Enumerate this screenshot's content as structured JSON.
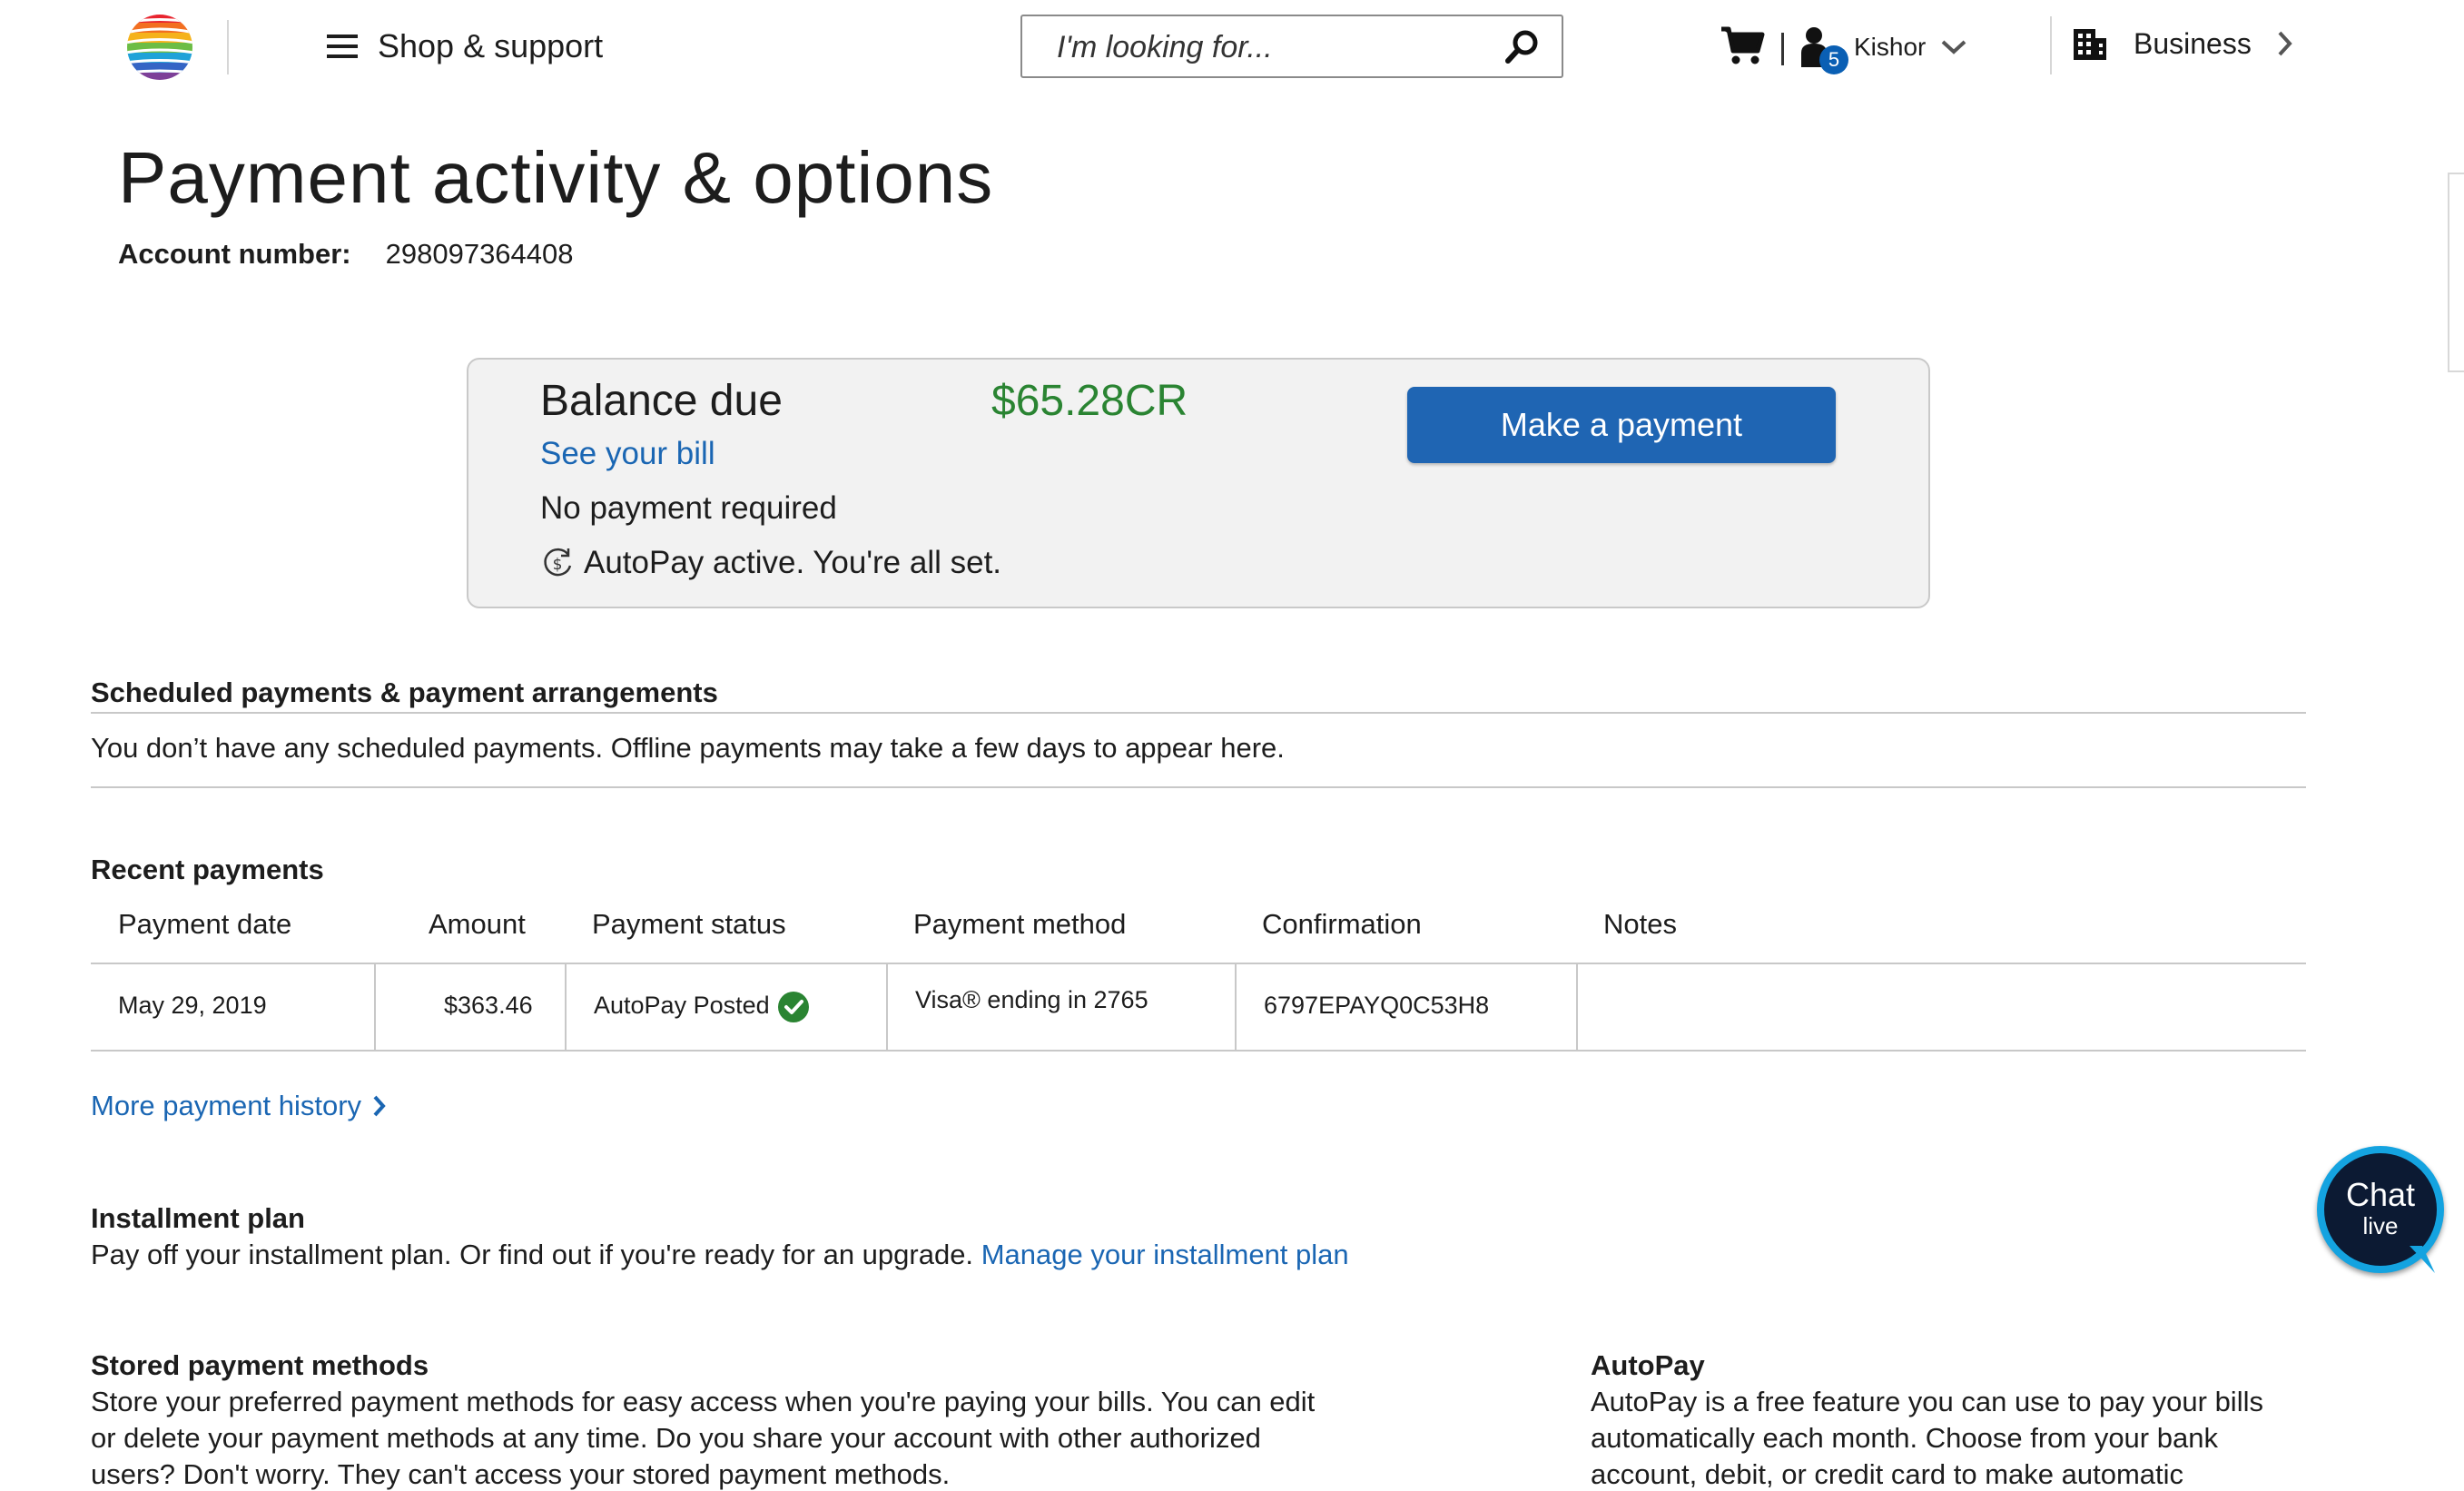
{
  "header": {
    "menu_label": "Shop & support",
    "search_placeholder": "I'm looking for...",
    "user_name": "Kishor",
    "user_badge": "5",
    "business_label": "Business"
  },
  "page": {
    "title": "Payment activity & options",
    "account_label": "Account number:",
    "account_number": "298097364408"
  },
  "balance": {
    "label": "Balance due",
    "amount": "$65.28CR",
    "see_bill": "See your bill",
    "no_payment": "No payment required",
    "autopay_status": "AutoPay active. You're all set.",
    "make_payment": "Make a payment"
  },
  "scheduled": {
    "heading": "Scheduled payments & payment arrangements",
    "message": "You don’t have any scheduled payments. Offline payments may take a few days to appear here."
  },
  "recent": {
    "heading": "Recent payments",
    "columns": [
      "Payment date",
      "Amount",
      "Payment status",
      "Payment method",
      "Confirmation",
      "Notes"
    ],
    "rows": [
      {
        "date": "May 29, 2019",
        "amount": "$363.46",
        "status": "AutoPay Posted",
        "method": "Visa® ending in 2765",
        "confirmation": "6797EPAYQ0C53H8",
        "notes": ""
      }
    ],
    "more_link": "More payment history"
  },
  "installment": {
    "heading": "Installment plan",
    "text": "Pay off your installment plan. Or find out if you're ready for an upgrade.",
    "link": "Manage your installment plan"
  },
  "stored": {
    "heading": "Stored payment methods",
    "line1": "Store your preferred payment methods for easy access when you're paying your bills. You can edit",
    "line2": "or delete your payment methods at any time. Do you share your account with other authorized",
    "line3": "users? Don't worry. They can't access your stored payment methods."
  },
  "autopay": {
    "heading": "AutoPay",
    "line1": "AutoPay is a free feature you can use to pay your bills",
    "line2": "automatically each month. Choose from your bank",
    "line3": "account, debit, or credit card to make automatic"
  },
  "chat": {
    "label": "Chat",
    "sub": "live"
  },
  "colors": {
    "link": "#1a66b3",
    "button": "#1f65b3",
    "credit_amount": "#2a8432",
    "chat_ring": "#14a3e0"
  }
}
